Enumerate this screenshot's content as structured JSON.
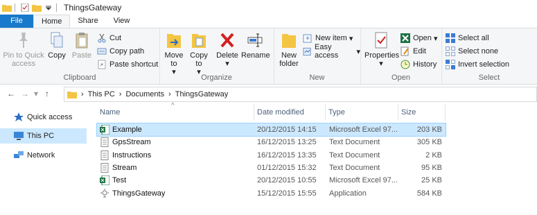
{
  "window": {
    "title": "ThingsGateway"
  },
  "tabs": {
    "file": "File",
    "home": "Home",
    "share": "Share",
    "view": "View"
  },
  "ribbon": {
    "clipboard": {
      "pin": "Pin to Quick access",
      "copy": "Copy",
      "paste": "Paste",
      "cut": "Cut",
      "copy_path": "Copy path",
      "paste_shortcut": "Paste shortcut",
      "label": "Clipboard"
    },
    "organize": {
      "move_to": "Move to",
      "copy_to": "Copy to",
      "delete": "Delete",
      "rename": "Rename",
      "label": "Organize"
    },
    "new": {
      "new_folder": "New folder",
      "new_item": "New item",
      "easy_access": "Easy access",
      "label": "New"
    },
    "open": {
      "properties": "Properties",
      "open": "Open",
      "edit": "Edit",
      "history": "History",
      "label": "Open"
    },
    "select": {
      "select_all": "Select all",
      "select_none": "Select none",
      "invert": "Invert selection",
      "label": "Select"
    }
  },
  "address": {
    "parts": [
      "This PC",
      "Documents",
      "ThingsGateway"
    ]
  },
  "nav": {
    "quick_access": "Quick access",
    "this_pc": "This PC",
    "network": "Network"
  },
  "columns": {
    "name": "Name",
    "date": "Date modified",
    "type": "Type",
    "size": "Size"
  },
  "files": [
    {
      "name": "Example",
      "date": "20/12/2015 14:15",
      "type": "Microsoft Excel 97...",
      "size": "203 KB",
      "icon": "excel-icon"
    },
    {
      "name": "GpsStream",
      "date": "16/12/2015 13:25",
      "type": "Text Document",
      "size": "305 KB",
      "icon": "text-file-icon"
    },
    {
      "name": "Instructions",
      "date": "16/12/2015 13:35",
      "type": "Text Document",
      "size": "2 KB",
      "icon": "text-file-icon"
    },
    {
      "name": "Stream",
      "date": "01/12/2015 15:32",
      "type": "Text Document",
      "size": "95 KB",
      "icon": "text-file-icon"
    },
    {
      "name": "Test",
      "date": "20/12/2015 10:55",
      "type": "Microsoft Excel 97...",
      "size": "25 KB",
      "icon": "excel-icon"
    },
    {
      "name": "ThingsGateway",
      "date": "15/12/2015 15:55",
      "type": "Application",
      "size": "584 KB",
      "icon": "application-icon"
    }
  ]
}
